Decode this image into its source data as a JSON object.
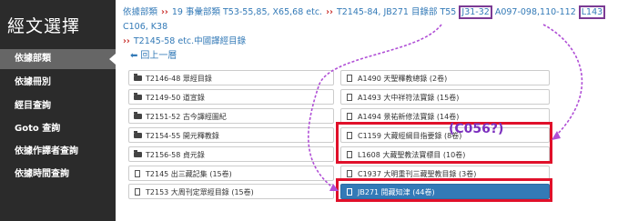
{
  "sidebar": {
    "title": "經文選擇",
    "items": [
      "依據部類",
      "依據冊別",
      "經目查詢",
      "Goto 查詢",
      "依據作譯者查詢",
      "依據時間查詢"
    ],
    "active_index": 0
  },
  "breadcrumb": {
    "line1": [
      "依據部類",
      "19 事彙部類 T53-55,85, X65,68 etc."
    ],
    "prefix": "T2145-84, JB271 目錄部 T55 ",
    "hl1": "J31-32",
    "mid": " A097-098,110-112 ",
    "hl2": "L143",
    "suffix": " C106, K38",
    "line2": "T2145-58 etc.中國譯經目錄"
  },
  "back_label": "回上一層",
  "left_items": [
    "T2146-48 眾經目錄",
    "T2149-50 道宣錄",
    "T2151-52 古今譯經圖紀",
    "T2154-55 開元釋教錄",
    "T2156-58 貞元錄",
    "T2145 出三藏記集 (15卷)",
    "T2153 大周刊定眾經目錄 (15卷)"
  ],
  "right_items": [
    "A1490 天聖釋教總錄 (2卷)",
    "A1493 大中祥符法寶錄 (15卷)",
    "A1494 景祐新修法寶錄 (14卷)",
    "C1159 大藏經綱目指要錄 (8卷)",
    "L1608 大藏聖教法寶標目 (10卷)",
    "C1937 大明重刊三藏聖教目錄 (3卷)",
    "JB271 閱藏知津 (44卷)"
  ],
  "selected_right_index": 6,
  "annotation": "(C056?)",
  "colors": {
    "sidebar_bg": "#2b2b2b",
    "link": "#337ab7",
    "highlight_box": "#e0102a",
    "annotation": "#7b2fbe"
  }
}
